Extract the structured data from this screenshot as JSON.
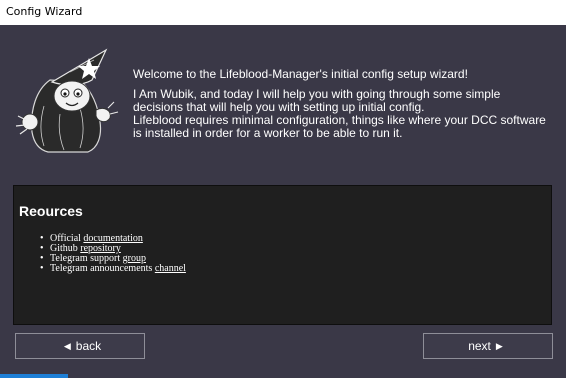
{
  "window": {
    "title": "Config Wizard"
  },
  "welcome": {
    "heading": "Welcome to the Lifeblood-Manager's initial config setup wizard!",
    "body": "I Am Wubik, and today I will help you with going through some simple decisions that will help you with setting up initial config.\nLifeblood requires minimal configuration, things like where your DCC software is installed in order for a worker to be able to run it."
  },
  "resources": {
    "title": "Reources",
    "items": [
      {
        "prefix": "Official ",
        "link": "documentation"
      },
      {
        "prefix": "Github ",
        "link": "repository"
      },
      {
        "prefix": "Telegram support ",
        "link": "group"
      },
      {
        "prefix": "Telegram announcements ",
        "link": "channel"
      }
    ]
  },
  "nav": {
    "back_label": "back",
    "next_label": "next"
  },
  "progress": {
    "fraction": 0.12,
    "color": "#1e7fd6"
  },
  "icons": {
    "mascot": "wizard-mascot-icon",
    "back": "triangle-left-icon",
    "next": "triangle-right-icon"
  }
}
